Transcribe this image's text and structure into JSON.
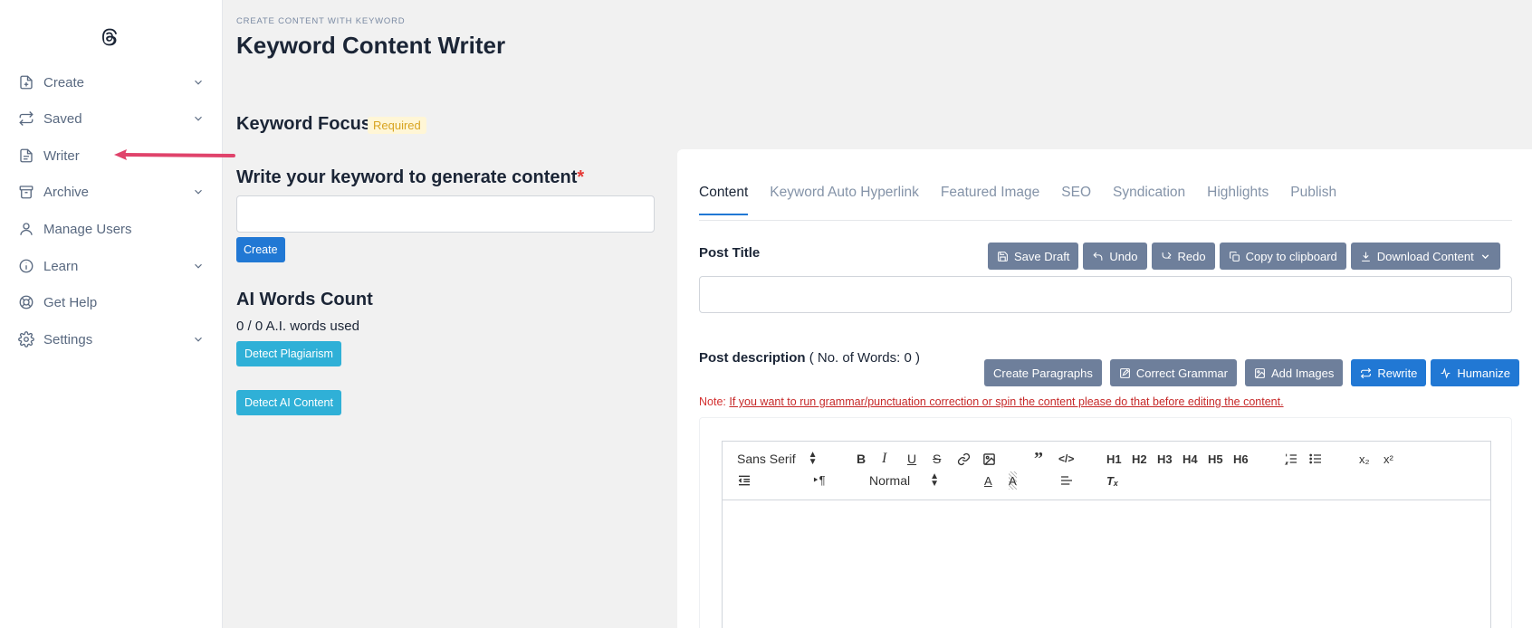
{
  "sidebar": {
    "logo_icon": "threads-at-icon",
    "items": [
      {
        "label": "Create",
        "icon": "file-plus-icon",
        "has_chevron": true
      },
      {
        "label": "Saved",
        "icon": "repeat-icon",
        "has_chevron": true
      },
      {
        "label": "Writer",
        "icon": "document-icon",
        "has_chevron": false
      },
      {
        "label": "Archive",
        "icon": "archive-icon",
        "has_chevron": true
      },
      {
        "label": "Manage Users",
        "icon": "user-icon",
        "has_chevron": false
      },
      {
        "label": "Learn",
        "icon": "info-icon",
        "has_chevron": true
      },
      {
        "label": "Get Help",
        "icon": "lifebuoy-icon",
        "has_chevron": false
      },
      {
        "label": "Settings",
        "icon": "gear-icon",
        "has_chevron": true
      }
    ]
  },
  "header": {
    "eyebrow": "CREATE CONTENT WITH KEYWORD",
    "title": "Keyword Content Writer"
  },
  "keyword_panel": {
    "focus_title": "Keyword Focus",
    "required_badge": "Required",
    "keyword_label": "Write your keyword to generate content",
    "required_mark": "*",
    "keyword_value": "",
    "create_button": "Create",
    "ai_words_title": "AI Words Count",
    "ai_words_text": "0 / 0 A.I. words used",
    "detect_plagiarism": "Detect Plagiarism",
    "detect_ai": "Detect AI Content"
  },
  "editor_panel": {
    "tabs": [
      "Content",
      "Keyword Auto Hyperlink",
      "Featured Image",
      "SEO",
      "Syndication",
      "Highlights",
      "Publish"
    ],
    "active_tab": "Content",
    "post_title_label": "Post Title",
    "post_title_value": "",
    "actions": {
      "save_draft": "Save Draft",
      "undo": "Undo",
      "redo": "Redo",
      "copy": "Copy to clipboard",
      "download": "Download Content"
    },
    "desc_label": "Post description",
    "desc_count": "( No. of Words: 0 )",
    "desc_actions": {
      "create_paragraphs": "Create Paragraphs",
      "correct_grammar": "Correct Grammar",
      "add_images": "Add Images",
      "rewrite": "Rewrite",
      "humanize": "Humanize"
    },
    "note_prefix": "Note:",
    "note_text": "If you want to run grammar/punctuation correction or spin the content please do that before editing the content.",
    "toolbar": {
      "font": "Sans Serif",
      "size": "Normal",
      "h1": "H1",
      "h2": "H2",
      "h3": "H3",
      "h4": "H4",
      "h5": "H5",
      "h6": "H6"
    }
  },
  "colors": {
    "primary": "#2178d4",
    "info": "#2fb0d7",
    "slate_button": "#6e7f9b",
    "arrow": "#e0436b"
  }
}
